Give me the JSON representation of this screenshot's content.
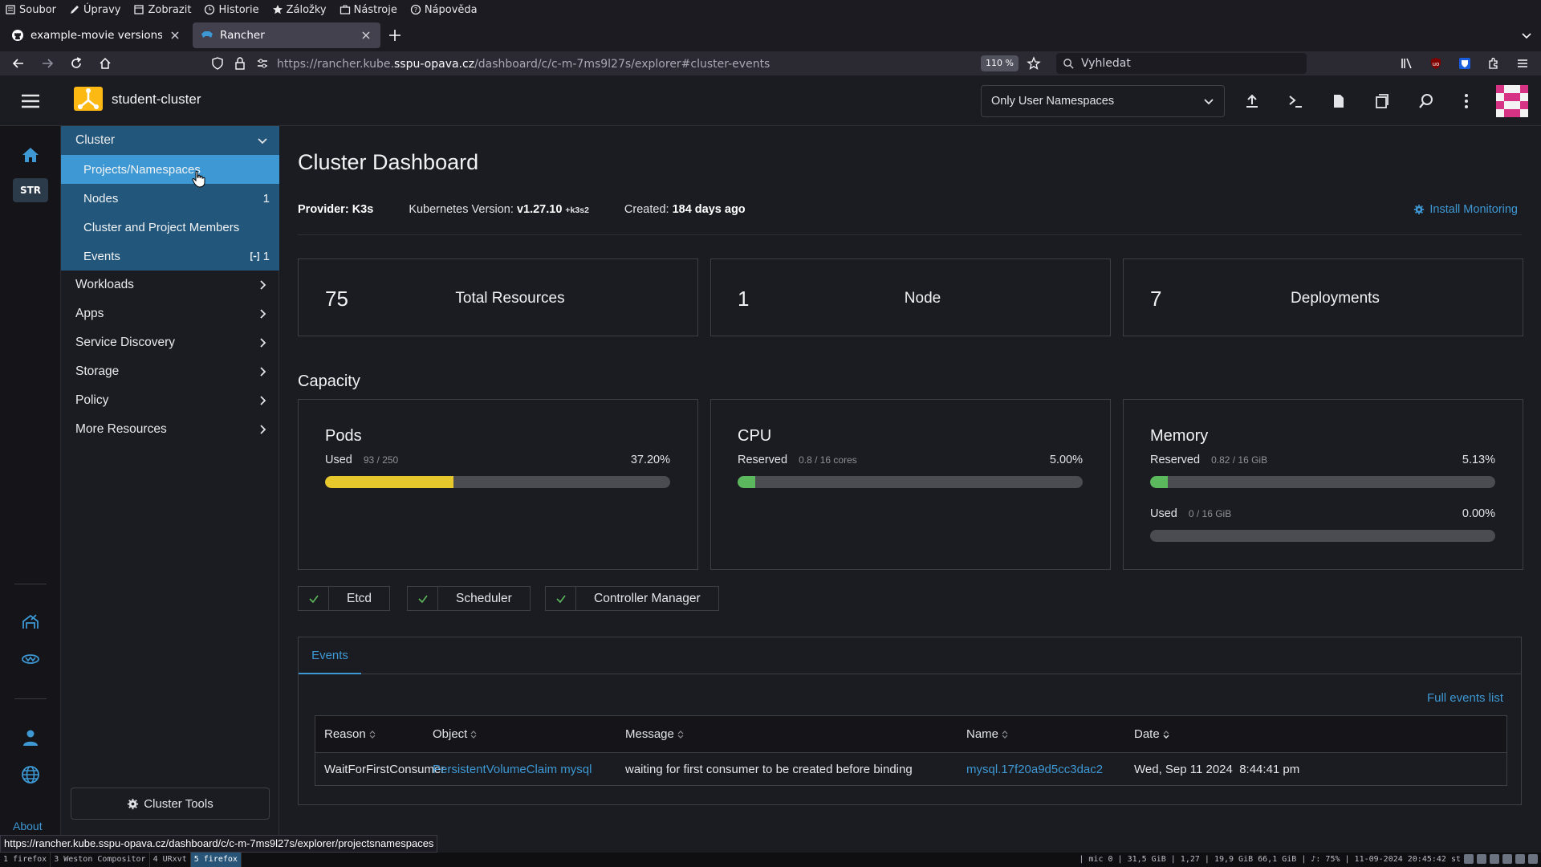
{
  "browser": {
    "menu": [
      "Soubor",
      "Úpravy",
      "Zobrazit",
      "Historie",
      "Záložky",
      "Nástroje",
      "Nápověda"
    ],
    "tabs": [
      {
        "label": "example-movie versions · jar",
        "icon": "github-icon"
      },
      {
        "label": "Rancher",
        "icon": "rancher-icon"
      }
    ],
    "url_prefix": "https://rancher.kube.",
    "url_host": "sspu-opava.cz",
    "url_path": "/dashboard/c/c-m-7ms9l27s/explorer#cluster-events",
    "zoom": "110 %",
    "search_placeholder": "Vyhledat",
    "status_url": "https://rancher.kube.sspu-opava.cz/dashboard/c/c-m-7ms9l27s/explorer/projectsnamespaces"
  },
  "header": {
    "cluster_name": "student-cluster",
    "namespace_filter": "Only User Namespaces"
  },
  "rail": {
    "badge": "STR",
    "about": "About"
  },
  "sidenav": {
    "group": "Cluster",
    "items": [
      {
        "label": "Projects/Namespaces",
        "count": ""
      },
      {
        "label": "Nodes",
        "count": "1"
      },
      {
        "label": "Cluster and Project Members",
        "count": ""
      },
      {
        "label": "Events",
        "count": "1"
      }
    ],
    "sections": [
      "Workloads",
      "Apps",
      "Service Discovery",
      "Storage",
      "Policy",
      "More Resources"
    ],
    "cluster_tools": "Cluster Tools"
  },
  "main": {
    "title": "Cluster Dashboard",
    "provider_label": "Provider:",
    "provider": "K3s",
    "k8s_label": "Kubernetes Version:",
    "k8s_version": "v1.27.10",
    "k8s_suffix": "+k3s2",
    "created_label": "Created:",
    "created": "184 days ago",
    "install_monitoring": "Install Monitoring",
    "counts": [
      {
        "value": "75",
        "label": "Total Resources"
      },
      {
        "value": "1",
        "label": "Node"
      },
      {
        "value": "7",
        "label": "Deployments"
      }
    ],
    "capacity_title": "Capacity",
    "capacity": [
      {
        "title": "Pods",
        "gauges": [
          {
            "label": "Used",
            "sub": "93 / 250",
            "pct": "37.20%",
            "fraction": 0.372,
            "color": "#e6c72c"
          }
        ]
      },
      {
        "title": "CPU",
        "gauges": [
          {
            "label": "Reserved",
            "sub": "0.8 / 16 cores",
            "pct": "5.00%",
            "fraction": 0.05,
            "color": "#5cb85c"
          }
        ]
      },
      {
        "title": "Memory",
        "gauges": [
          {
            "label": "Reserved",
            "sub": "0.82 / 16 GiB",
            "pct": "5.13%",
            "fraction": 0.0513,
            "color": "#5cb85c"
          },
          {
            "label": "Used",
            "sub": "0 / 16 GiB",
            "pct": "0.00%",
            "fraction": 0.0,
            "color": "#5cb85c"
          }
        ]
      }
    ],
    "components": [
      "Etcd",
      "Scheduler",
      "Controller Manager"
    ],
    "events_tab": "Events",
    "full_events": "Full events list",
    "events_columns": [
      "Reason",
      "Object",
      "Message",
      "Name",
      "Date"
    ],
    "events_rows": [
      {
        "reason": "WaitForFirstConsumer",
        "object": "PersistentVolumeClaim mysql",
        "message": "waiting for first consumer to be created before binding",
        "name": "mysql.17f20a9d5cc3dac2",
        "date": "Wed, Sep 11 2024  8:44:41 pm"
      }
    ]
  },
  "wm": {
    "workspaces": [
      "1 firefox",
      "3 Weston Compositor",
      "4 URxvt",
      "5 firefox"
    ],
    "status": "| mic 0 | 31,5 GiB | 1,27 | 19,9 GiB 66,1 GiB | ♪: 75% | 11-09-2024 20:45:42 st"
  }
}
